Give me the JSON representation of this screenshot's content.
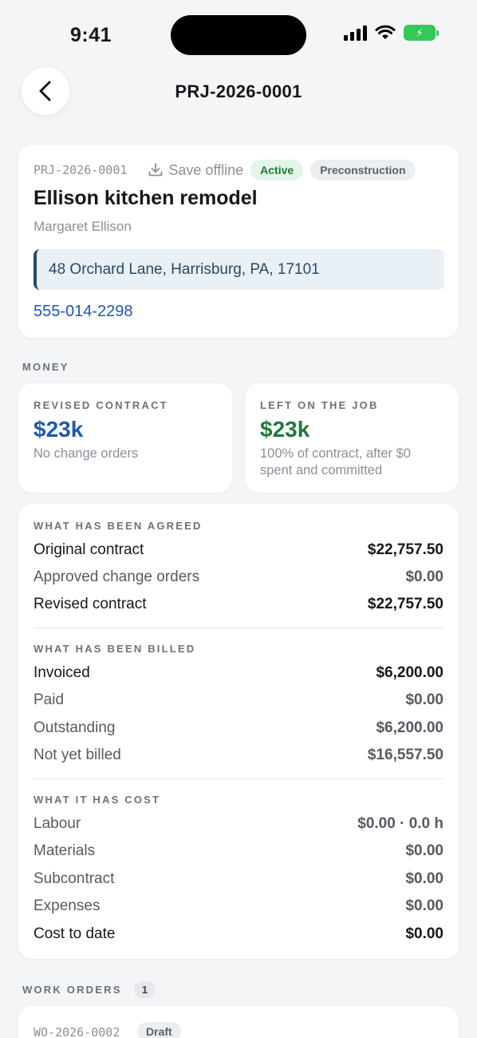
{
  "status_bar": {
    "time": "9:41"
  },
  "nav": {
    "title": "PRJ-2026-0001"
  },
  "project": {
    "code": "PRJ-2026-0001",
    "save_offline_label": "Save offline",
    "status_badge": "Active",
    "phase_badge": "Preconstruction",
    "title": "Ellison kitchen remodel",
    "client": "Margaret Ellison",
    "address": "48 Orchard Lane, Harrisburg, PA, 17101",
    "phone": "555-014-2298"
  },
  "money": {
    "section_label": "MONEY",
    "revised_contract": {
      "label": "REVISED CONTRACT",
      "value": "$23k",
      "sub": "No change orders"
    },
    "left_on_job": {
      "label": "LEFT ON THE JOB",
      "value": "$23k",
      "sub": "100% of contract, after $0 spent and committed"
    }
  },
  "agreed": {
    "heading": "WHAT HAS BEEN AGREED",
    "rows": [
      {
        "label": "Original contract",
        "value": "$22,757.50"
      },
      {
        "label": "Approved change orders",
        "value": "$0.00"
      },
      {
        "label": "Revised contract",
        "value": "$22,757.50"
      }
    ]
  },
  "billed": {
    "heading": "WHAT HAS BEEN BILLED",
    "rows": [
      {
        "label": "Invoiced",
        "value": "$6,200.00"
      },
      {
        "label": "Paid",
        "value": "$0.00"
      },
      {
        "label": "Outstanding",
        "value": "$6,200.00"
      },
      {
        "label": "Not yet billed",
        "value": "$16,557.50"
      }
    ]
  },
  "cost": {
    "heading": "WHAT IT HAS COST",
    "rows": [
      {
        "label": "Labour",
        "value": "$0.00 · 0.0 h"
      },
      {
        "label": "Materials",
        "value": "$0.00"
      },
      {
        "label": "Subcontract",
        "value": "$0.00"
      },
      {
        "label": "Expenses",
        "value": "$0.00"
      },
      {
        "label": "Cost to date",
        "value": "$0.00"
      }
    ]
  },
  "work_orders": {
    "section_label": "WORK ORDERS",
    "count": "1",
    "items": [
      {
        "code": "WO-2026-0002",
        "status": "Draft"
      }
    ]
  },
  "colors": {
    "accent_blue": "#1e58b0",
    "positive_green": "#1f7a3a",
    "battery_green": "#34c759",
    "address_bg": "#e9f0f6"
  }
}
